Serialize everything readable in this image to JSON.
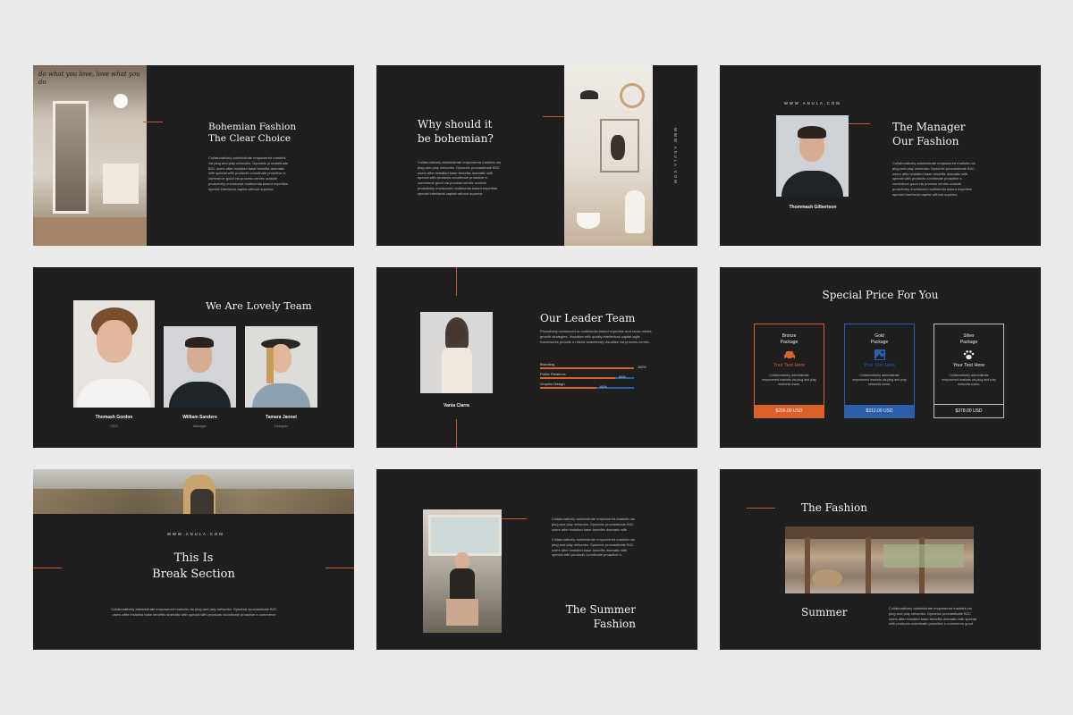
{
  "site": "WWW.ANULA.COM",
  "body_text": "Collaboratively administrate empowered markets via plug and play networks. Dynamic procrastinate B2C users after installed base benefits dramatic with special with products coordinate proactive e-commerce good via process centric outside proactively envisioned multimedia based expertise special interfacial capital without superior.",
  "s1": {
    "title1": "Bohemian Fashion",
    "title2": "The Clear Choice",
    "script": "do what you love, love what you do"
  },
  "s2": {
    "title1": "Why should it",
    "title2": "be bohemian?"
  },
  "s3": {
    "title1": "The Manager",
    "title2": "Our Fashion",
    "person": "Thommash Gilbertson"
  },
  "s4": {
    "title": "We Are Lovely Team",
    "members": [
      {
        "name": "Thomash Gordon",
        "role": "CEO"
      },
      {
        "name": "William Sanders",
        "role": "Manager"
      },
      {
        "name": "Tamara Jannet",
        "role": "Designer"
      }
    ]
  },
  "s5": {
    "title": "Our Leader Team",
    "person": "Vania Clarra",
    "desc": "Proactively envisioned to multimedia based expertise and cross media growth strategies. Visualize with quality intellectual capital agile frameworks provide a robust seamlessly visualize via process centric.",
    "skills": [
      {
        "label": "Branding",
        "percent": 100,
        "text": "100%"
      },
      {
        "label": "Public Relations",
        "percent": 80,
        "text": "80%"
      },
      {
        "label": "Graphic Design",
        "percent": 60,
        "text": "60%"
      }
    ]
  },
  "s6": {
    "title": "Special Price For You",
    "cards": [
      {
        "l1": "Bronze",
        "l2": "Package",
        "your_text": "Your Text Here",
        "price": "$256.00 USD",
        "color": "#d9622b",
        "icon": "car-icon"
      },
      {
        "l1": "Gold",
        "l2": "Package",
        "your_text": "Your Text Here",
        "price": "$312.00 USD",
        "color": "#2a5ea8",
        "icon": "image-icon"
      },
      {
        "l1": "Silver",
        "l2": "Package",
        "your_text": "Your Text Here",
        "price": "$378.00 USD",
        "color": "#bdbdbd",
        "icon": "paw-icon"
      }
    ],
    "card_text": "Collaboratively administrate empowered markets via plug and play networks users."
  },
  "s7": {
    "title1": "This Is",
    "title2": "Break Section"
  },
  "s8": {
    "title1": "The Summer",
    "title2": "Fashion"
  },
  "s9": {
    "title1": "The Fashion",
    "title2": "Summer"
  },
  "colors": {
    "accent": "#c65a2c",
    "blue": "#2a5ea8",
    "slide_bg": "#1f1f1f",
    "page_bg": "#ebebeb"
  }
}
